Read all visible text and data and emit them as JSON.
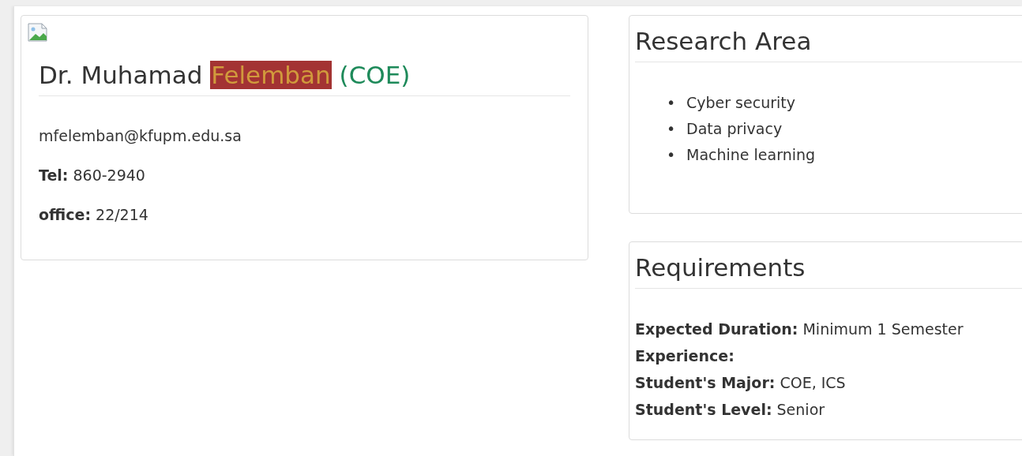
{
  "profile": {
    "name": "Dr. Muhamad",
    "highlight": "Felemban",
    "department": "(COE)",
    "email": "mfelemban@kfupm.edu.sa",
    "details": [
      "**Tel:** 860-2940",
      "**office:** 22/214"
    ]
  },
  "research_area": {
    "title": "Research Area",
    "bullet": "•",
    "items": [
      "Cyber security",
      "Data privacy",
      "Machine learning"
    ]
  },
  "requirements": {
    "title": "Requirements",
    "items": [
      {
        "label": "Expected Duration:",
        "value": "Minimum 1 Semester"
      },
      {
        "label": "Experience:"
      },
      {
        "label": "Student's Major:",
        "value": "COE, ICS"
      },
      {
        "label": "Student's Level:",
        "value": "Senior"
      }
    ]
  }
}
